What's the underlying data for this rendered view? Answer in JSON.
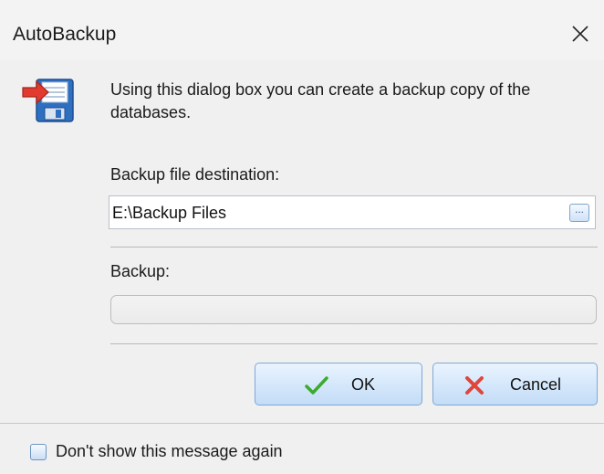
{
  "window": {
    "title": "AutoBackup"
  },
  "dialog": {
    "intro_text": "Using this dialog box you can create a backup copy of the databases.",
    "destination_label": "Backup file destination:",
    "destination_value": "E:\\Backup Files",
    "browse_button_label": "...",
    "backup_label": "Backup:",
    "backup_progress": 0
  },
  "buttons": {
    "ok_label": "OK",
    "cancel_label": "Cancel"
  },
  "footer": {
    "checkbox_label": "Don't show this message again",
    "checkbox_checked": false
  },
  "icons": {
    "app": "save-disk-icon",
    "ok": "checkmark-icon",
    "cancel": "red-x-icon",
    "close": "close-icon"
  },
  "colors": {
    "button_border": "#7ea8d6",
    "ok_check": "#3bab2f",
    "cancel_x": "#e0463b",
    "disk_blue": "#2f6fc0",
    "arrow_red": "#e23a2e"
  }
}
